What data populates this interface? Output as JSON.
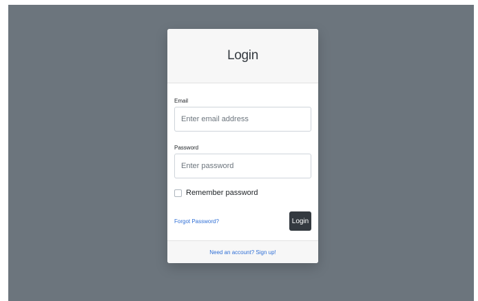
{
  "card": {
    "title": "Login"
  },
  "form": {
    "email": {
      "label": "Email",
      "placeholder": "Enter email address",
      "value": ""
    },
    "password": {
      "label": "Password",
      "placeholder": "Enter password",
      "value": ""
    },
    "remember": {
      "label": "Remember password",
      "checked": false
    },
    "forgot_link": "Forgot Password?",
    "submit_label": "Login"
  },
  "footer": {
    "signup_link": "Need an account? Sign up!"
  },
  "colors": {
    "backdrop": "#6c757d",
    "button": "#343a40",
    "link": "#2f6fd6"
  }
}
